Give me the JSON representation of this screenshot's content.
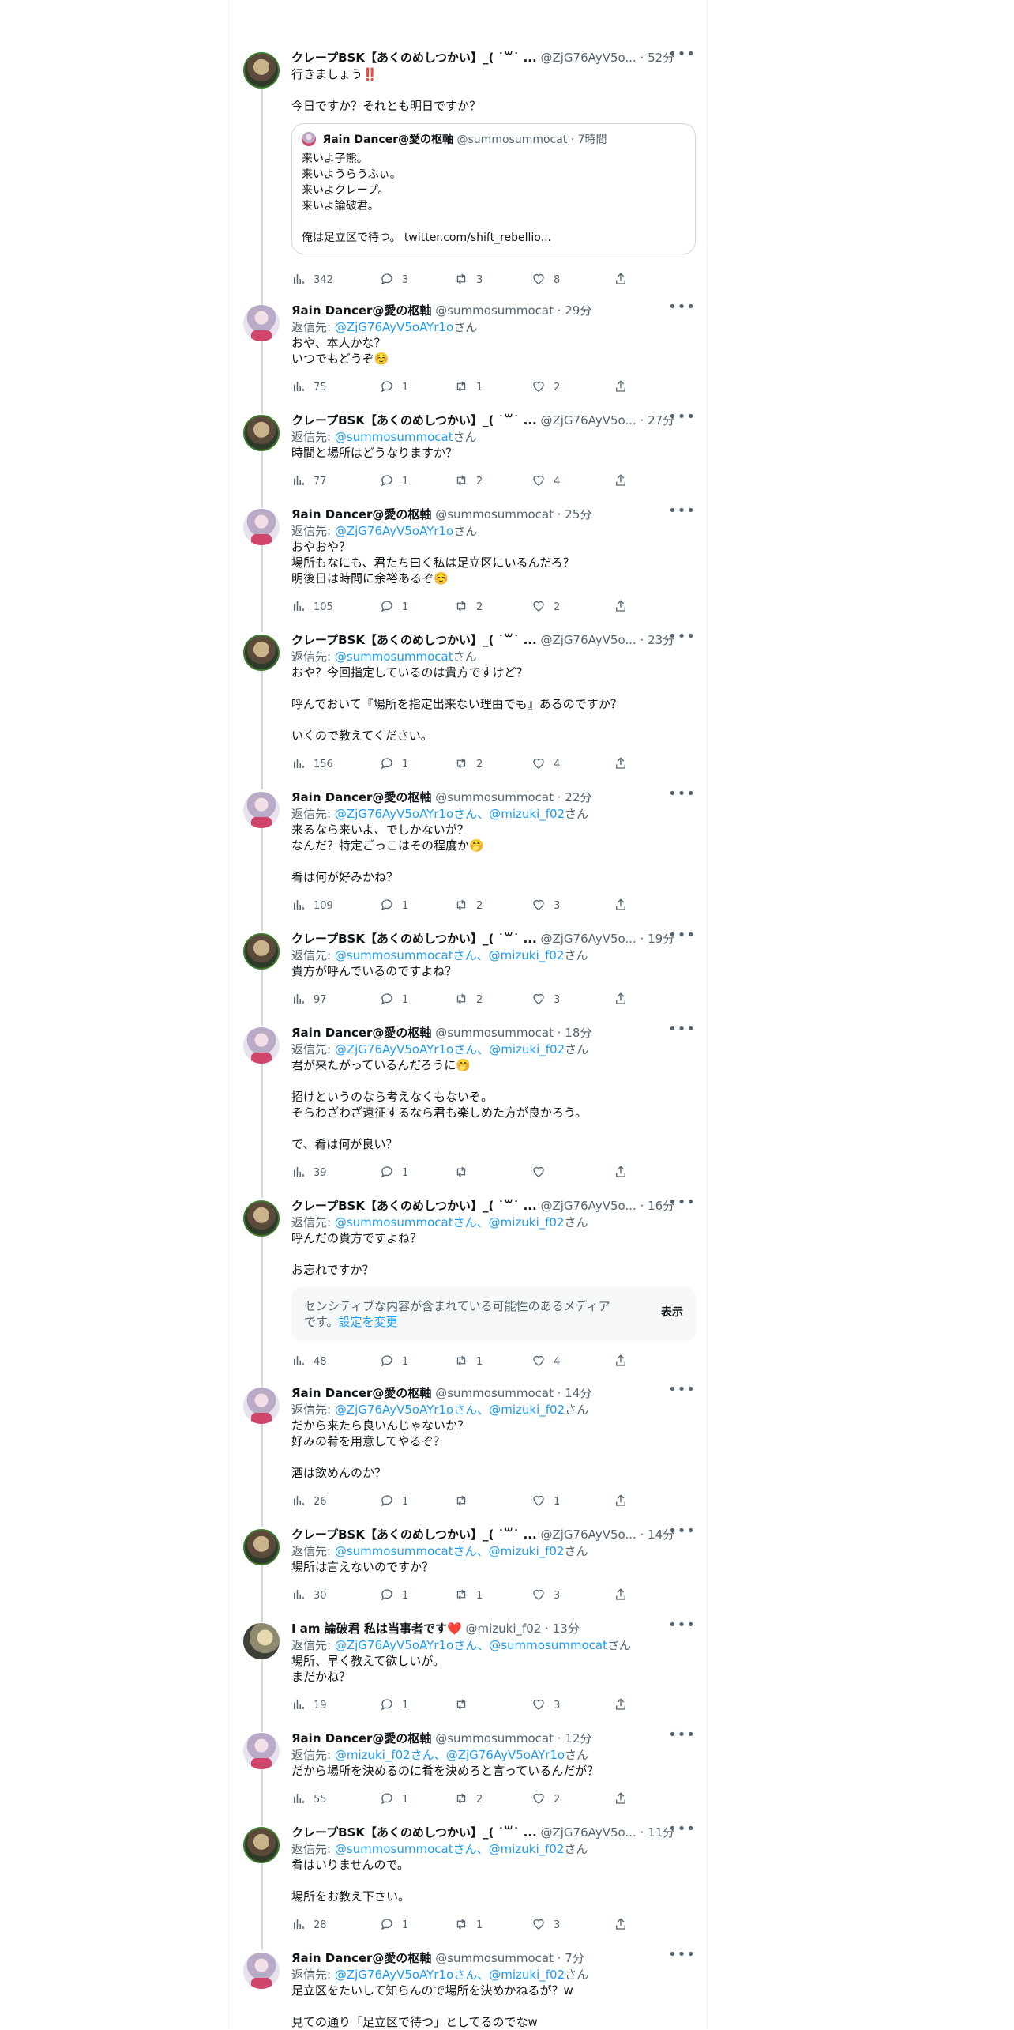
{
  "tweets": [
    {
      "author": "クレープBSK【あくのめしつかい】_( ˙꒳˙ ...",
      "handle": "@ZjG76AyV5o...",
      "time": "· 52分",
      "reply_prefix": "",
      "reply_targets": "",
      "reply_suffix": "",
      "text": "行きましょう‼️\n\n今日ですか？それとも明日ですか？",
      "views": "342",
      "replies": "3",
      "retweets": "3",
      "likes": "8",
      "quote": {
        "author": "Яain Dancer@愛の枢軸",
        "handle": "@summosummocat",
        "time": "· 7時間",
        "text": "来いよ子熊。\n来いようらうふぃ。\n来いよクレープ。\n来いよ論破君。\n\n俺は足立区で待つ。 twitter.com/shift_rebellio..."
      }
    },
    {
      "author": "Яain Dancer@愛の枢軸",
      "handle": "@summosummocat",
      "time": "· 29分",
      "reply_prefix": "返信先: ",
      "reply_targets": "@ZjG76AyV5oAYr1o",
      "reply_suffix": "さん",
      "text": "おや、本人かな？\nいつでもどうぞ☺️",
      "views": "75",
      "replies": "1",
      "retweets": "1",
      "likes": "2"
    },
    {
      "author": "クレープBSK【あくのめしつかい】_( ˙꒳˙ ...",
      "handle": "@ZjG76AyV5o...",
      "time": "· 27分",
      "reply_prefix": "返信先: ",
      "reply_targets": "@summosummocat",
      "reply_suffix": "さん",
      "text": "時間と場所はどうなりますか？",
      "views": "77",
      "replies": "1",
      "retweets": "2",
      "likes": "4"
    },
    {
      "author": "Яain Dancer@愛の枢軸",
      "handle": "@summosummocat",
      "time": "· 25分",
      "reply_prefix": "返信先: ",
      "reply_targets": "@ZjG76AyV5oAYr1o",
      "reply_suffix": "さん",
      "text": "おやおや？\n場所もなにも、君たち曰く私は足立区にいるんだろ？\n明後日は時間に余裕あるぞ☺️",
      "views": "105",
      "replies": "1",
      "retweets": "2",
      "likes": "2"
    },
    {
      "author": "クレープBSK【あくのめしつかい】_( ˙꒳˙ ...",
      "handle": "@ZjG76AyV5o...",
      "time": "· 23分",
      "reply_prefix": "返信先: ",
      "reply_targets": "@summosummocat",
      "reply_suffix": "さん",
      "text": "おや？今回指定しているのは貴方ですけど？\n\n呼んでおいて『場所を指定出来ない理由でも』あるのですか？\n\nいくので教えてください。",
      "views": "156",
      "replies": "1",
      "retweets": "2",
      "likes": "4"
    },
    {
      "author": "Яain Dancer@愛の枢軸",
      "handle": "@summosummocat",
      "time": "· 22分",
      "reply_prefix": "返信先: ",
      "reply_targets": "@ZjG76AyV5oAYr1oさん、@mizuki_f02",
      "reply_suffix": "さん",
      "text": "来るなら来いよ、でしかないが？\nなんだ？特定ごっこはその程度か🤭\n\n肴は何が好みかね？",
      "views": "109",
      "replies": "1",
      "retweets": "2",
      "likes": "3"
    },
    {
      "author": "クレープBSK【あくのめしつかい】_( ˙꒳˙ ...",
      "handle": "@ZjG76AyV5o...",
      "time": "· 19分",
      "reply_prefix": "返信先: ",
      "reply_targets": "@summosummocatさん、@mizuki_f02",
      "reply_suffix": "さん",
      "text": "貴方が呼んでいるのですよね？",
      "views": "97",
      "replies": "1",
      "retweets": "2",
      "likes": "3"
    },
    {
      "author": "Яain Dancer@愛の枢軸",
      "handle": "@summosummocat",
      "time": "· 18分",
      "reply_prefix": "返信先: ",
      "reply_targets": "@ZjG76AyV5oAYr1oさん、@mizuki_f02",
      "reply_suffix": "さん",
      "text": "君が来たがっているんだろうに🤭\n\n招けというのなら考えなくもないぞ。\nそらわざわざ遠征するなら君も楽しめた方が良かろう。\n\nで、肴は何が良い？",
      "views": "39",
      "replies": "1",
      "retweets": "",
      "likes": ""
    },
    {
      "author": "クレープBSK【あくのめしつかい】_( ˙꒳˙ ...",
      "handle": "@ZjG76AyV5o...",
      "time": "· 16分",
      "reply_prefix": "返信先: ",
      "reply_targets": "@summosummocatさん、@mizuki_f02",
      "reply_suffix": "さん",
      "text": "呼んだの貴方ですよね？\n\nお忘れですか？",
      "views": "48",
      "replies": "1",
      "retweets": "1",
      "likes": "4",
      "sensitive": {
        "text": "センシティブな内容が含まれている可能性のあるメディアです。",
        "link": "設定を変更",
        "show": "表示"
      }
    },
    {
      "author": "Яain Dancer@愛の枢軸",
      "handle": "@summosummocat",
      "time": "· 14分",
      "reply_prefix": "返信先: ",
      "reply_targets": "@ZjG76AyV5oAYr1oさん、@mizuki_f02",
      "reply_suffix": "さん",
      "text": "だから来たら良いんじゃないか？\n好みの肴を用意してやるぞ？\n\n酒は飲めんのか？",
      "views": "26",
      "replies": "1",
      "retweets": "",
      "likes": "1"
    },
    {
      "author": "クレープBSK【あくのめしつかい】_( ˙꒳˙ ...",
      "handle": "@ZjG76AyV5o...",
      "time": "· 14分",
      "reply_prefix": "返信先: ",
      "reply_targets": "@summosummocatさん、@mizuki_f02",
      "reply_suffix": "さん",
      "text": "場所は言えないのですか？",
      "views": "30",
      "replies": "1",
      "retweets": "1",
      "likes": "3"
    },
    {
      "author": "I am 論破君 私は当事者です❤️",
      "handle": "@mizuki_f02",
      "time": "· 13分",
      "reply_prefix": "返信先: ",
      "reply_targets": "@ZjG76AyV5oAYr1oさん、@summosummocat",
      "reply_suffix": "さん",
      "text": "場所、早く教えて欲しいが。\nまだかね？",
      "views": "19",
      "replies": "1",
      "retweets": "",
      "likes": "3"
    },
    {
      "author": "Яain Dancer@愛の枢軸",
      "handle": "@summosummocat",
      "time": "· 12分",
      "reply_prefix": "返信先: ",
      "reply_targets": "@mizuki_f02さん、@ZjG76AyV5oAYr1o",
      "reply_suffix": "さん",
      "text": "だから場所を決めるのに肴を決めろと言っているんだが？",
      "views": "55",
      "replies": "1",
      "retweets": "2",
      "likes": "2"
    },
    {
      "author": "クレープBSK【あくのめしつかい】_( ˙꒳˙ ...",
      "handle": "@ZjG76AyV5o...",
      "time": "· 11分",
      "reply_prefix": "返信先: ",
      "reply_targets": "@summosummocatさん、@mizuki_f02",
      "reply_suffix": "さん",
      "text": "肴はいりませんので。\n\n場所をお教え下さい。",
      "views": "28",
      "replies": "1",
      "retweets": "1",
      "likes": "3"
    },
    {
      "author": "Яain Dancer@愛の枢軸",
      "handle": "@summosummocat",
      "time": "· 7分",
      "reply_prefix": "返信先: ",
      "reply_targets": "@ZjG76AyV5oAYr1oさん、@mizuki_f02",
      "reply_suffix": "さん",
      "text": "足立区をたいして知らんので場所を決めかねるが？w\n\n見ての通り「足立区で待つ」としてるのでなw",
      "views": "",
      "replies": "",
      "retweets": "",
      "likes": ""
    }
  ]
}
